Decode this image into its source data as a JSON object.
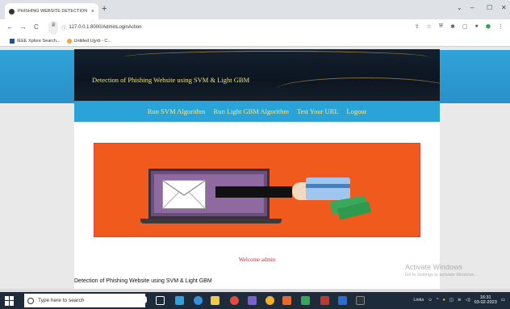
{
  "browser": {
    "tab_title": "PHISHING WEBSITE DETECTION",
    "tab_close": "×",
    "new_tab": "+",
    "back": "←",
    "forward": "→",
    "reload": "C",
    "url_chip": "ༀ",
    "url": "127.0.0.1:8000/AdminLoginAction",
    "bookmarks": [
      "IEEE Xplore Search...",
      "Untitled Ujyrb - C..."
    ]
  },
  "page": {
    "header_title": "Detection of Phishing Website using SVM & Light GBM",
    "menu": [
      "Run SVM Algorithm",
      "Run Light GBM Algorithm",
      "Test Your URL",
      "Logout"
    ],
    "welcome": "Welcome admin",
    "footer": "Detection of Phishing Website using SVM & Light GBM"
  },
  "watermark": {
    "line1": "Activate Windows",
    "line2": "Go to Settings to activate Windows."
  },
  "taskbar": {
    "search_placeholder": "Type here to search",
    "tray_links": "Links",
    "time": "16:31",
    "date": "03-02-2023",
    "accent": "#1d2b3a"
  }
}
